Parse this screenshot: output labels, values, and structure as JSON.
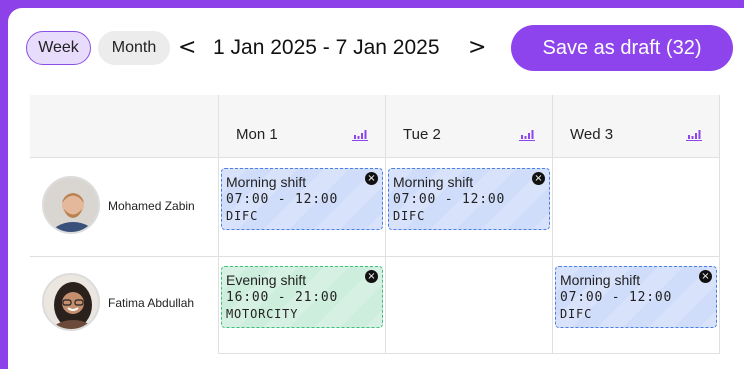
{
  "toolbar": {
    "week_label": "Week",
    "month_label": "Month",
    "prev_icon": "<",
    "next_icon": ">",
    "date_range": "1 Jan 2025 - 7 Jan 2025",
    "save_label": "Save as draft (32)"
  },
  "days": [
    {
      "label": "Mon 1",
      "icon": "bar-chart-icon"
    },
    {
      "label": "Tue 2",
      "icon": "bar-chart-icon"
    },
    {
      "label": "Wed 3",
      "icon": "bar-chart-icon"
    }
  ],
  "employees": [
    {
      "name": "Mohamed Zabin"
    },
    {
      "name": "Fatima Abdullah"
    }
  ],
  "shifts": [
    {
      "title": "Morning shift",
      "hours": "07:00 - 12:00",
      "location": "DIFC",
      "close_icon": "×"
    },
    {
      "title": "Morning shift",
      "hours": "07:00 - 12:00",
      "location": "DIFC",
      "close_icon": "×"
    },
    {
      "title": "Evening shift",
      "hours": "16:00 - 21:00",
      "location": "MOTORCITY",
      "close_icon": "×"
    },
    {
      "title": "Morning shift",
      "hours": "07:00 - 12:00",
      "location": "DIFC",
      "close_icon": "×"
    }
  ],
  "colors": {
    "accent": "#8e44ec",
    "shift_blue": "#cfdcfa",
    "shift_green": "#cdeedd"
  }
}
